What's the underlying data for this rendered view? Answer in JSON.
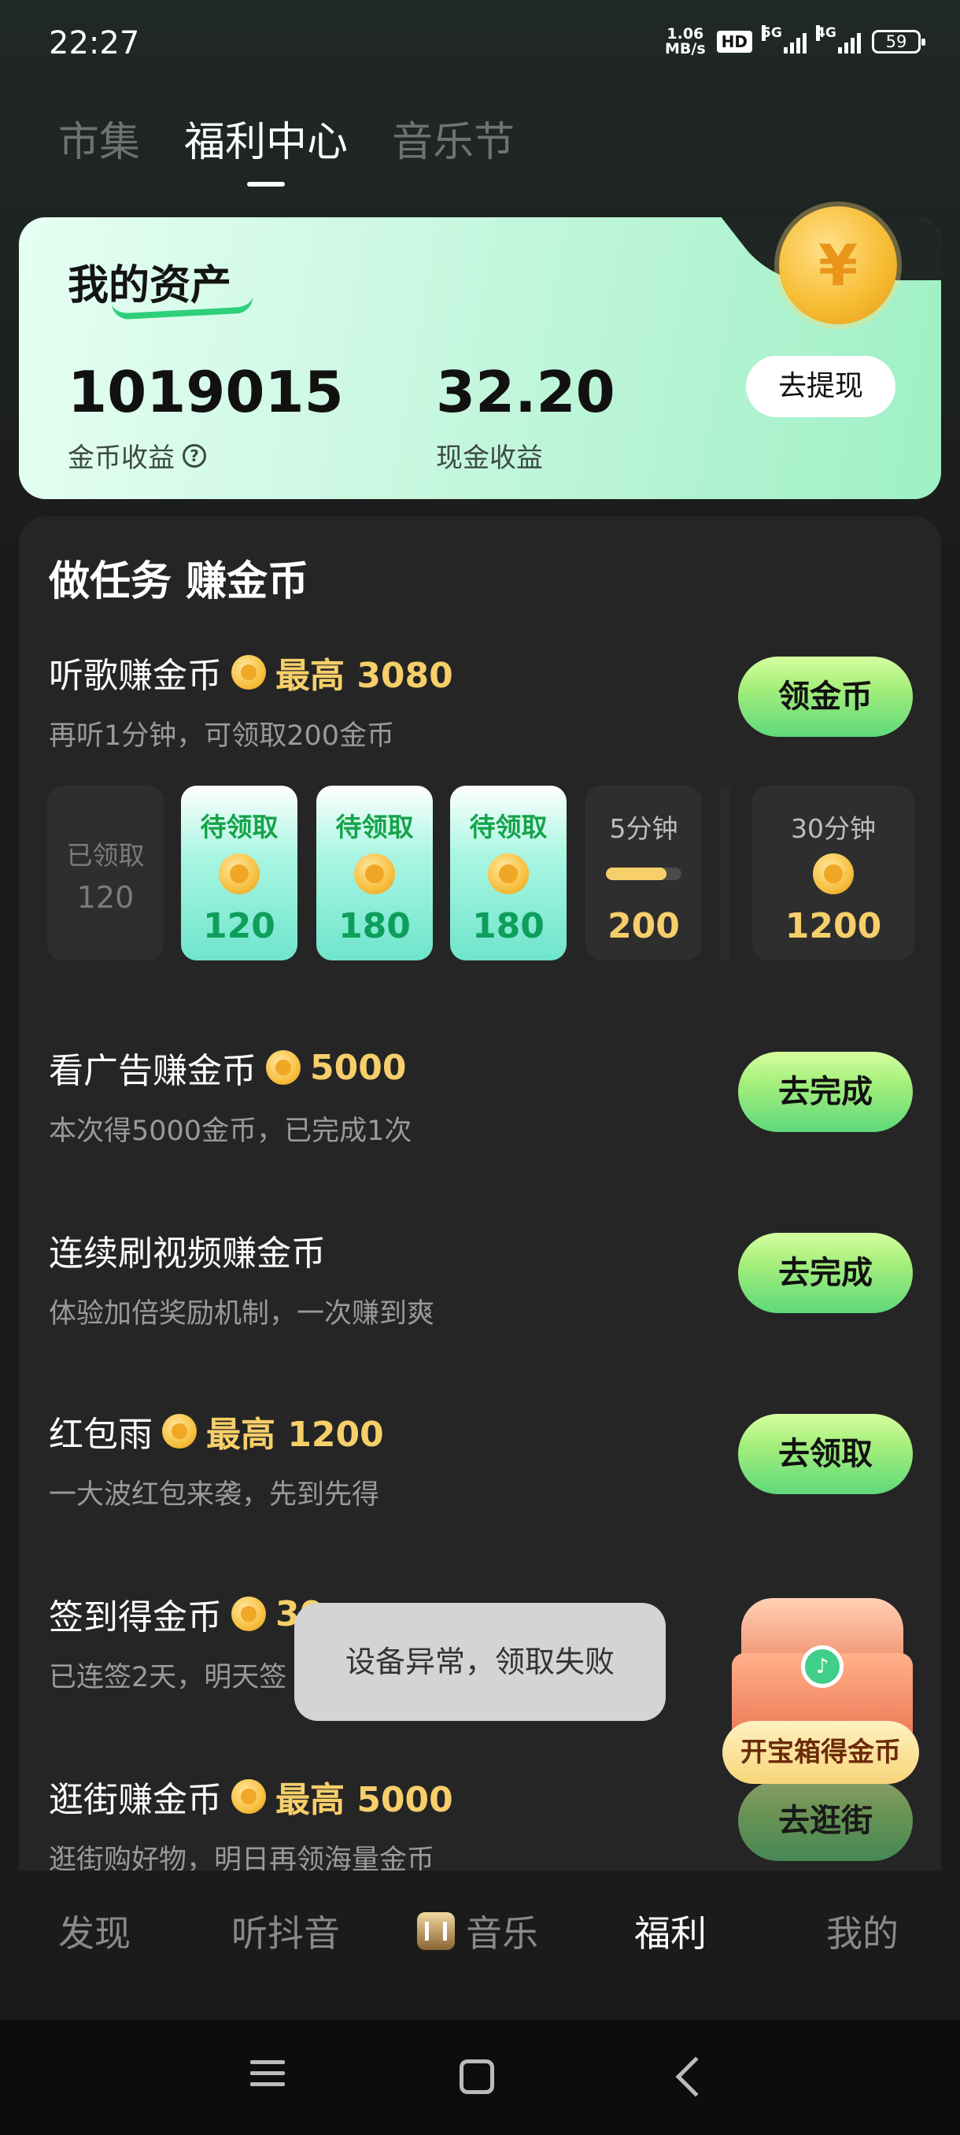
{
  "status_bar": {
    "time": "22:27",
    "speed_value": "1.06",
    "speed_unit": "MB/s",
    "hd_badge": "HD",
    "net1": "5G",
    "net2": "4G",
    "battery": "59"
  },
  "top_tabs": [
    {
      "label": "市集"
    },
    {
      "label": "福利中心",
      "active": true
    },
    {
      "label": "音乐节"
    }
  ],
  "assets": {
    "title": "我的资产",
    "coins_value": "1019015",
    "coins_label": "金币收益",
    "cash_value": "32.20",
    "cash_label": "现金收益",
    "withdraw_label": "去提现"
  },
  "tasks_title": "做任务 赚金币",
  "tasks": {
    "listen": {
      "name": "听歌赚金币",
      "reward": "最高 3080",
      "desc": "再听1分钟，可领取200金币",
      "button": "领金币"
    },
    "ads": {
      "name": "看广告赚金币",
      "reward": "5000",
      "desc": "本次得5000金币，已完成1次",
      "button": "去完成"
    },
    "video": {
      "name": "连续刷视频赚金币",
      "desc": "体验加倍奖励机制，一次赚到爽",
      "button": "去完成"
    },
    "redpacket": {
      "name": "红包雨",
      "reward": "最高 1200",
      "desc": "一大波红包来袭，先到先得",
      "button": "去领取"
    },
    "checkin": {
      "name": "签到得金币",
      "reward": "30",
      "desc": "已连签2天，明天签"
    },
    "shop": {
      "name": "逛街赚金币",
      "reward": "最高 5000",
      "desc": "逛街购好物，明日再领海量金币",
      "button": "去逛街"
    }
  },
  "timeline": [
    {
      "top": "已领取",
      "value": "120",
      "state": "done"
    },
    {
      "top": "待领取",
      "value": "120",
      "state": "pending"
    },
    {
      "top": "待领取",
      "value": "180",
      "state": "pending"
    },
    {
      "top": "待领取",
      "value": "180",
      "state": "pending"
    },
    {
      "top": "5分钟",
      "value": "200",
      "state": "future",
      "progress": 0.8
    },
    {
      "top": "30分钟",
      "value": "1200",
      "state": "future"
    }
  ],
  "toast": "设备异常，领取失败",
  "chest_label": "开宝箱得金币",
  "bottom_nav": [
    {
      "label": "发现"
    },
    {
      "label": "听抖音"
    },
    {
      "label": "音乐"
    },
    {
      "label": "福利",
      "active": true
    },
    {
      "label": "我的"
    }
  ],
  "colors": {
    "accent_green": "#5fd97b",
    "coin_gold": "#f6cf6a",
    "background": "#1b1b1b"
  }
}
